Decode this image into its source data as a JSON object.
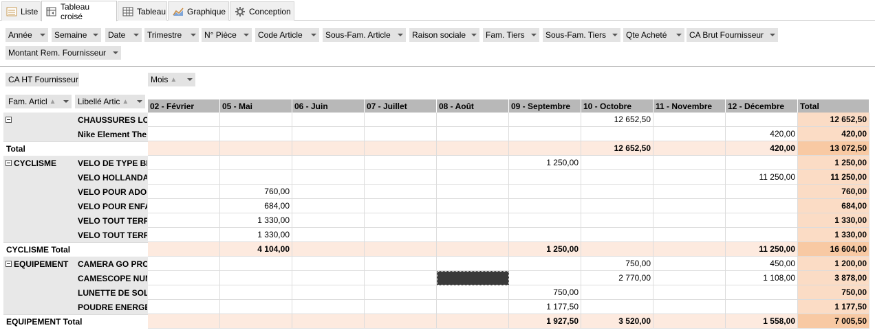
{
  "tabs": [
    {
      "label": "Liste",
      "icon": "list-icon"
    },
    {
      "label": "Tableau croisé",
      "icon": "pivot-icon"
    },
    {
      "label": "Tableau",
      "icon": "table-icon"
    },
    {
      "label": "Graphique",
      "icon": "chart-icon"
    },
    {
      "label": "Conception",
      "icon": "gear-icon"
    }
  ],
  "filters": [
    "Année",
    "Semaine",
    "Date",
    "Trimestre",
    "N° Pièce",
    "Code Article",
    "Sous-Fam. Article",
    "Raison sociale",
    "Fam. Tiers",
    "Sous-Fam. Tiers",
    "Qte Acheté",
    "CA Brut Fournisseur",
    "Montant Rem. Fournisseur"
  ],
  "data_field": "CA HT Fournisseur",
  "column_field": "Mois",
  "row_fields": [
    "Fam. Articl",
    "Libellé Artic"
  ],
  "columns": [
    "02 - Février",
    "05 - Mai",
    "06 - Juin",
    "07 - Juillet",
    "08 - Août",
    "09 - Septembre",
    "10 - Octobre",
    "11 - Novembre",
    "12 - Décembre",
    "Total"
  ],
  "rows": [
    {
      "group": "",
      "item": "CHAUSSURES LOI",
      "values": [
        "",
        "",
        "",
        "",
        "",
        "",
        "12 652,50",
        "",
        "",
        "12 652,50"
      ],
      "kind": "item",
      "expander": true
    },
    {
      "group": "",
      "item": "Nike Element The",
      "values": [
        "",
        "",
        "",
        "",
        "",
        "",
        "",
        "",
        "420,00",
        "420,00"
      ],
      "kind": "item"
    },
    {
      "group": "Total",
      "item": "",
      "values": [
        "",
        "",
        "",
        "",
        "",
        "",
        "12 652,50",
        "",
        "420,00",
        "13 072,50"
      ],
      "kind": "subtotal"
    },
    {
      "group": "CYCLISME",
      "item": "VELO DE TYPE BM",
      "values": [
        "",
        "",
        "",
        "",
        "",
        "1 250,00",
        "",
        "",
        "",
        "1 250,00"
      ],
      "kind": "item",
      "expander": true
    },
    {
      "group": "",
      "item": "VELO HOLLANDAI",
      "values": [
        "",
        "",
        "",
        "",
        "",
        "",
        "",
        "",
        "11 250,00",
        "11 250,00"
      ],
      "kind": "item"
    },
    {
      "group": "",
      "item": "VELO POUR ADO",
      "values": [
        "",
        "760,00",
        "",
        "",
        "",
        "",
        "",
        "",
        "",
        "760,00"
      ],
      "kind": "item"
    },
    {
      "group": "",
      "item": "VELO POUR ENFAI",
      "values": [
        "",
        "684,00",
        "",
        "",
        "",
        "",
        "",
        "",
        "",
        "684,00"
      ],
      "kind": "item"
    },
    {
      "group": "",
      "item": "VELO TOUT TERRA",
      "values": [
        "",
        "1 330,00",
        "",
        "",
        "",
        "",
        "",
        "",
        "",
        "1 330,00"
      ],
      "kind": "item"
    },
    {
      "group": "",
      "item": "VELO TOUT TERRA",
      "values": [
        "",
        "1 330,00",
        "",
        "",
        "",
        "",
        "",
        "",
        "",
        "1 330,00"
      ],
      "kind": "item"
    },
    {
      "group": "CYCLISME Total",
      "item": "",
      "values": [
        "",
        "4 104,00",
        "",
        "",
        "",
        "1 250,00",
        "",
        "",
        "11 250,00",
        "16 604,00"
      ],
      "kind": "subtotal"
    },
    {
      "group": "EQUIPEMENT",
      "item": "CAMERA GO PRO",
      "values": [
        "",
        "",
        "",
        "",
        "",
        "",
        "750,00",
        "",
        "450,00",
        "1 200,00"
      ],
      "kind": "item",
      "expander": true
    },
    {
      "group": "",
      "item": "CAMESCOPE NUM",
      "values": [
        "",
        "",
        "",
        "",
        "",
        "",
        "2 770,00",
        "",
        "1 108,00",
        "3 878,00"
      ],
      "kind": "item"
    },
    {
      "group": "",
      "item": "LUNETTE DE SOLE",
      "values": [
        "",
        "",
        "",
        "",
        "",
        "750,00",
        "",
        "",
        "",
        "750,00"
      ],
      "kind": "item"
    },
    {
      "group": "",
      "item": "POUDRE ENERGET",
      "values": [
        "",
        "",
        "",
        "",
        "",
        "1 177,50",
        "",
        "",
        "",
        "1 177,50"
      ],
      "kind": "item"
    },
    {
      "group": "EQUIPEMENT Total",
      "item": "",
      "values": [
        "",
        "",
        "",
        "",
        "",
        "1 927,50",
        "3 520,00",
        "",
        "1 558,00",
        "7 005,50"
      ],
      "kind": "subtotal"
    }
  ],
  "selected_cell": {
    "row": 11,
    "col": 4
  }
}
